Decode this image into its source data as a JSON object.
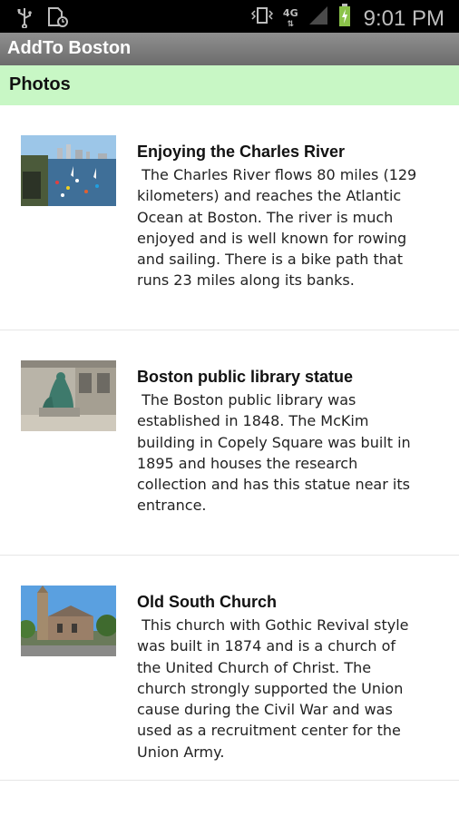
{
  "status_bar": {
    "left_icons": [
      "usb-icon",
      "sd-card-icon"
    ],
    "right_icons": [
      "vibrate-icon",
      "network-4g-icon",
      "signal-icon",
      "battery-charging-icon"
    ],
    "network_label": "4G",
    "time": "9:01 PM"
  },
  "app": {
    "title": "AddTo Boston"
  },
  "section": {
    "title": "Photos"
  },
  "items": [
    {
      "title": "Enjoying the Charles River",
      "description": " The Charles River flows 80 miles (129\nkilometers) and reaches the Atlantic\nOcean at Boston. The river is much\nenjoyed and is well known for rowing\nand sailing. There is a bike path that\nruns 23 miles along its banks."
    },
    {
      "title": "Boston public library statue",
      "description": " The Boston public library was\nestablished in 1848. The McKim\nbuilding in Copely Square was built in\n1895 and houses the research\ncollection and has this statue near its\nentrance."
    },
    {
      "title": "Old South Church",
      "description": " This church with Gothic Revival style\nwas built in 1874 and is a church of\nthe United Church of Christ. The\nchurch strongly supported the Union\ncause during the Civil War and was\nused as a recruitment center for the\nUnion Army."
    }
  ],
  "colors": {
    "section_bg": "#c8f7c5",
    "titlebar_bg": "#7d7d7d",
    "statusbar_bg": "#000000"
  }
}
